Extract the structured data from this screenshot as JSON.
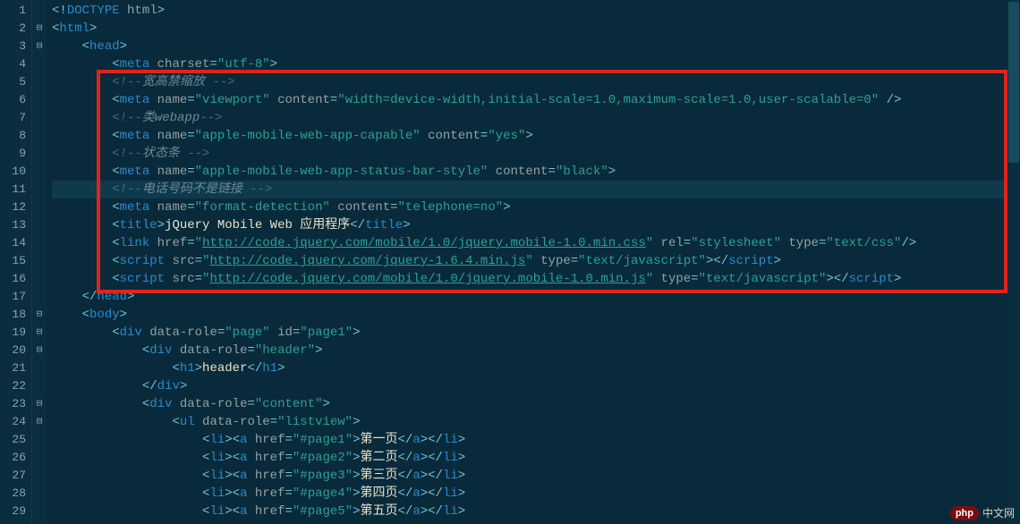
{
  "watermark": {
    "badge": "php",
    "text": "中文网"
  },
  "lines": [
    {
      "n": 1,
      "fold": "",
      "indent": 0,
      "tokens": [
        [
          "p",
          "<!"
        ],
        [
          "t",
          "DOCTYPE"
        ],
        [
          "a",
          " html"
        ],
        [
          "p",
          ">"
        ]
      ]
    },
    {
      "n": 2,
      "fold": "⊟",
      "indent": 0,
      "tokens": [
        [
          "p",
          "<"
        ],
        [
          "t",
          "html"
        ],
        [
          "p",
          ">"
        ]
      ]
    },
    {
      "n": 3,
      "fold": "⊟",
      "indent": 1,
      "tokens": [
        [
          "p",
          "<"
        ],
        [
          "t",
          "head"
        ],
        [
          "p",
          ">"
        ]
      ]
    },
    {
      "n": 4,
      "fold": "",
      "indent": 2,
      "tokens": [
        [
          "p",
          "<"
        ],
        [
          "t",
          "meta"
        ],
        [
          "a",
          " charset"
        ],
        [
          "p",
          "="
        ],
        [
          "s",
          "\"utf-8\""
        ],
        [
          "p",
          ">"
        ]
      ]
    },
    {
      "n": 5,
      "fold": "",
      "indent": 2,
      "tokens": [
        [
          "c",
          "<!--"
        ],
        [
          "cc",
          "宽高禁缩放 "
        ],
        [
          "c",
          "-->"
        ]
      ]
    },
    {
      "n": 6,
      "fold": "",
      "indent": 2,
      "tokens": [
        [
          "p",
          "<"
        ],
        [
          "t",
          "meta"
        ],
        [
          "a",
          " name"
        ],
        [
          "p",
          "="
        ],
        [
          "s",
          "\"viewport\""
        ],
        [
          "a",
          " content"
        ],
        [
          "p",
          "="
        ],
        [
          "s",
          "\"width=device-width,initial-scale=1.0,maximum-scale=1.0,user-scalable=0\""
        ],
        [
          "p",
          " />"
        ]
      ]
    },
    {
      "n": 7,
      "fold": "",
      "indent": 2,
      "tokens": [
        [
          "c",
          "<!--"
        ],
        [
          "cc",
          "类webapp"
        ],
        [
          "c",
          "-->"
        ]
      ]
    },
    {
      "n": 8,
      "fold": "",
      "indent": 2,
      "tokens": [
        [
          "p",
          "<"
        ],
        [
          "t",
          "meta"
        ],
        [
          "a",
          " name"
        ],
        [
          "p",
          "="
        ],
        [
          "s",
          "\"apple-mobile-web-app-capable\""
        ],
        [
          "a",
          " content"
        ],
        [
          "p",
          "="
        ],
        [
          "s",
          "\"yes\""
        ],
        [
          "p",
          ">"
        ]
      ]
    },
    {
      "n": 9,
      "fold": "",
      "indent": 2,
      "tokens": [
        [
          "c",
          "<!--"
        ],
        [
          "cc",
          "状态条 "
        ],
        [
          "c",
          "-->"
        ]
      ]
    },
    {
      "n": 10,
      "fold": "",
      "indent": 2,
      "tokens": [
        [
          "p",
          "<"
        ],
        [
          "t",
          "meta"
        ],
        [
          "a",
          " name"
        ],
        [
          "p",
          "="
        ],
        [
          "s",
          "\"apple-mobile-web-app-status-bar-style\""
        ],
        [
          "a",
          " content"
        ],
        [
          "p",
          "="
        ],
        [
          "s",
          "\"black\""
        ],
        [
          "p",
          ">"
        ]
      ]
    },
    {
      "n": 11,
      "fold": "",
      "indent": 2,
      "hl": true,
      "tokens": [
        [
          "c",
          "<!--"
        ],
        [
          "cc",
          "电话号码不是链接 "
        ],
        [
          "c",
          "-->"
        ]
      ]
    },
    {
      "n": 12,
      "fold": "",
      "indent": 2,
      "tokens": [
        [
          "p",
          "<"
        ],
        [
          "t",
          "meta"
        ],
        [
          "a",
          " name"
        ],
        [
          "p",
          "="
        ],
        [
          "s",
          "\"format-detection\""
        ],
        [
          "a",
          " content"
        ],
        [
          "p",
          "="
        ],
        [
          "s",
          "\"telephone=no\""
        ],
        [
          "p",
          ">"
        ]
      ]
    },
    {
      "n": 13,
      "fold": "",
      "indent": 2,
      "tokens": [
        [
          "p",
          "<"
        ],
        [
          "t",
          "title"
        ],
        [
          "p",
          ">"
        ],
        [
          "tx",
          "jQuery Mobile Web 应用程序"
        ],
        [
          "p",
          "</"
        ],
        [
          "t",
          "title"
        ],
        [
          "p",
          ">"
        ]
      ]
    },
    {
      "n": 14,
      "fold": "",
      "indent": 2,
      "tokens": [
        [
          "p",
          "<"
        ],
        [
          "t",
          "link"
        ],
        [
          "a",
          " href"
        ],
        [
          "p",
          "="
        ],
        [
          "s",
          "\""
        ],
        [
          "lnk",
          "http://code.jquery.com/mobile/1.0/jquery.mobile-1.0.min.css"
        ],
        [
          "s",
          "\""
        ],
        [
          "a",
          " rel"
        ],
        [
          "p",
          "="
        ],
        [
          "s",
          "\"stylesheet\""
        ],
        [
          "a",
          " type"
        ],
        [
          "p",
          "="
        ],
        [
          "s",
          "\"text/css\""
        ],
        [
          "p",
          "/>"
        ]
      ]
    },
    {
      "n": 15,
      "fold": "",
      "indent": 2,
      "tokens": [
        [
          "p",
          "<"
        ],
        [
          "t",
          "script"
        ],
        [
          "a",
          " src"
        ],
        [
          "p",
          "="
        ],
        [
          "s",
          "\""
        ],
        [
          "lnk",
          "http://code.jquery.com/jquery-1.6.4.min.js"
        ],
        [
          "s",
          "\""
        ],
        [
          "a",
          " type"
        ],
        [
          "p",
          "="
        ],
        [
          "s",
          "\"text/javascript\""
        ],
        [
          "p",
          "></"
        ],
        [
          "t",
          "script"
        ],
        [
          "p",
          ">"
        ]
      ]
    },
    {
      "n": 16,
      "fold": "",
      "indent": 2,
      "tokens": [
        [
          "p",
          "<"
        ],
        [
          "t",
          "script"
        ],
        [
          "a",
          " src"
        ],
        [
          "p",
          "="
        ],
        [
          "s",
          "\""
        ],
        [
          "lnk",
          "http://code.jquery.com/mobile/1.0/jquery.mobile-1.0.min.js"
        ],
        [
          "s",
          "\""
        ],
        [
          "a",
          " type"
        ],
        [
          "p",
          "="
        ],
        [
          "s",
          "\"text/javascript\""
        ],
        [
          "p",
          "></"
        ],
        [
          "t",
          "script"
        ],
        [
          "p",
          ">"
        ]
      ]
    },
    {
      "n": 17,
      "fold": "",
      "indent": 1,
      "tokens": [
        [
          "p",
          "</"
        ],
        [
          "t",
          "head"
        ],
        [
          "p",
          ">"
        ]
      ]
    },
    {
      "n": 18,
      "fold": "⊟",
      "indent": 1,
      "tokens": [
        [
          "p",
          "<"
        ],
        [
          "t",
          "body"
        ],
        [
          "p",
          ">"
        ]
      ]
    },
    {
      "n": 19,
      "fold": "⊟",
      "indent": 2,
      "tokens": [
        [
          "p",
          "<"
        ],
        [
          "t",
          "div"
        ],
        [
          "a",
          " data-role"
        ],
        [
          "p",
          "="
        ],
        [
          "s",
          "\"page\""
        ],
        [
          "a",
          " id"
        ],
        [
          "p",
          "="
        ],
        [
          "s",
          "\"page1\""
        ],
        [
          "p",
          ">"
        ]
      ]
    },
    {
      "n": 20,
      "fold": "⊟",
      "indent": 3,
      "tokens": [
        [
          "p",
          "<"
        ],
        [
          "t",
          "div"
        ],
        [
          "a",
          " data-role"
        ],
        [
          "p",
          "="
        ],
        [
          "s",
          "\"header\""
        ],
        [
          "p",
          ">"
        ]
      ]
    },
    {
      "n": 21,
      "fold": "",
      "indent": 4,
      "tokens": [
        [
          "p",
          "<"
        ],
        [
          "t",
          "h1"
        ],
        [
          "p",
          ">"
        ],
        [
          "tx",
          "header"
        ],
        [
          "p",
          "</"
        ],
        [
          "t",
          "h1"
        ],
        [
          "p",
          ">"
        ]
      ]
    },
    {
      "n": 22,
      "fold": "",
      "indent": 3,
      "tokens": [
        [
          "p",
          "</"
        ],
        [
          "t",
          "div"
        ],
        [
          "p",
          ">"
        ]
      ]
    },
    {
      "n": 23,
      "fold": "⊟",
      "indent": 3,
      "tokens": [
        [
          "p",
          "<"
        ],
        [
          "t",
          "div"
        ],
        [
          "a",
          " data-role"
        ],
        [
          "p",
          "="
        ],
        [
          "s",
          "\"content\""
        ],
        [
          "p",
          ">"
        ]
      ]
    },
    {
      "n": 24,
      "fold": "⊟",
      "indent": 4,
      "tokens": [
        [
          "p",
          "<"
        ],
        [
          "t",
          "ul"
        ],
        [
          "a",
          " data-role"
        ],
        [
          "p",
          "="
        ],
        [
          "s",
          "\"listview\""
        ],
        [
          "p",
          ">"
        ]
      ]
    },
    {
      "n": 25,
      "fold": "",
      "indent": 5,
      "tokens": [
        [
          "p",
          "<"
        ],
        [
          "t",
          "li"
        ],
        [
          "p",
          "><"
        ],
        [
          "t",
          "a"
        ],
        [
          "a",
          " href"
        ],
        [
          "p",
          "="
        ],
        [
          "s",
          "\"#page1\""
        ],
        [
          "p",
          ">"
        ],
        [
          "tx",
          "第一页"
        ],
        [
          "p",
          "</"
        ],
        [
          "t",
          "a"
        ],
        [
          "p",
          "></"
        ],
        [
          "t",
          "li"
        ],
        [
          "p",
          ">"
        ]
      ]
    },
    {
      "n": 26,
      "fold": "",
      "indent": 5,
      "tokens": [
        [
          "p",
          "<"
        ],
        [
          "t",
          "li"
        ],
        [
          "p",
          "><"
        ],
        [
          "t",
          "a"
        ],
        [
          "a",
          " href"
        ],
        [
          "p",
          "="
        ],
        [
          "s",
          "\"#page2\""
        ],
        [
          "p",
          ">"
        ],
        [
          "tx",
          "第二页"
        ],
        [
          "p",
          "</"
        ],
        [
          "t",
          "a"
        ],
        [
          "p",
          "></"
        ],
        [
          "t",
          "li"
        ],
        [
          "p",
          ">"
        ]
      ]
    },
    {
      "n": 27,
      "fold": "",
      "indent": 5,
      "tokens": [
        [
          "p",
          "<"
        ],
        [
          "t",
          "li"
        ],
        [
          "p",
          "><"
        ],
        [
          "t",
          "a"
        ],
        [
          "a",
          " href"
        ],
        [
          "p",
          "="
        ],
        [
          "s",
          "\"#page3\""
        ],
        [
          "p",
          ">"
        ],
        [
          "tx",
          "第三页"
        ],
        [
          "p",
          "</"
        ],
        [
          "t",
          "a"
        ],
        [
          "p",
          "></"
        ],
        [
          "t",
          "li"
        ],
        [
          "p",
          ">"
        ]
      ]
    },
    {
      "n": 28,
      "fold": "",
      "indent": 5,
      "tokens": [
        [
          "p",
          "<"
        ],
        [
          "t",
          "li"
        ],
        [
          "p",
          "><"
        ],
        [
          "t",
          "a"
        ],
        [
          "a",
          " href"
        ],
        [
          "p",
          "="
        ],
        [
          "s",
          "\"#page4\""
        ],
        [
          "p",
          ">"
        ],
        [
          "tx",
          "第四页"
        ],
        [
          "p",
          "</"
        ],
        [
          "t",
          "a"
        ],
        [
          "p",
          "></"
        ],
        [
          "t",
          "li"
        ],
        [
          "p",
          ">"
        ]
      ]
    },
    {
      "n": 29,
      "fold": "",
      "indent": 5,
      "tokens": [
        [
          "p",
          "<"
        ],
        [
          "t",
          "li"
        ],
        [
          "p",
          "><"
        ],
        [
          "t",
          "a"
        ],
        [
          "a",
          " href"
        ],
        [
          "p",
          "="
        ],
        [
          "s",
          "\"#page5\""
        ],
        [
          "p",
          ">"
        ],
        [
          "tx",
          "第五页"
        ],
        [
          "p",
          "</"
        ],
        [
          "t",
          "a"
        ],
        [
          "p",
          "></"
        ],
        [
          "t",
          "li"
        ],
        [
          "p",
          ">"
        ]
      ]
    }
  ]
}
